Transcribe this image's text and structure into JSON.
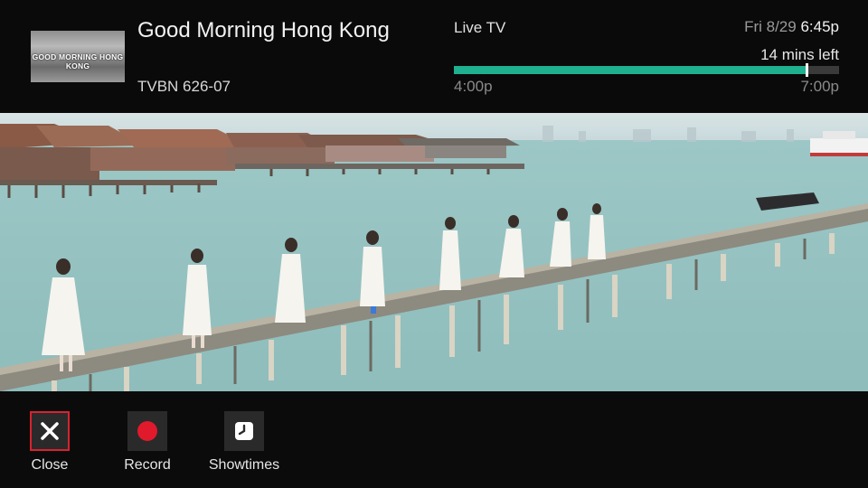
{
  "program": {
    "title": "Good Morning Hong Kong",
    "channel": "TVBN 626-07",
    "thumbnail_text": "GOOD MORNING HONG KONG"
  },
  "status": {
    "live_label": "Live TV",
    "date": "Fri 8/29",
    "time": "6:45p",
    "remaining": "14 mins left",
    "start_time": "4:00p",
    "end_time": "7:00p",
    "progress": 0.915
  },
  "actions": [
    {
      "label": "Close",
      "icon": "close-icon",
      "selected": true
    },
    {
      "label": "Record",
      "icon": "record-icon",
      "selected": false
    },
    {
      "label": "Showtimes",
      "icon": "clock-icon",
      "selected": false
    }
  ],
  "colors": {
    "progress_fill": "#1fb090",
    "selection_border": "#d8222f",
    "record_red": "#e1192c"
  }
}
